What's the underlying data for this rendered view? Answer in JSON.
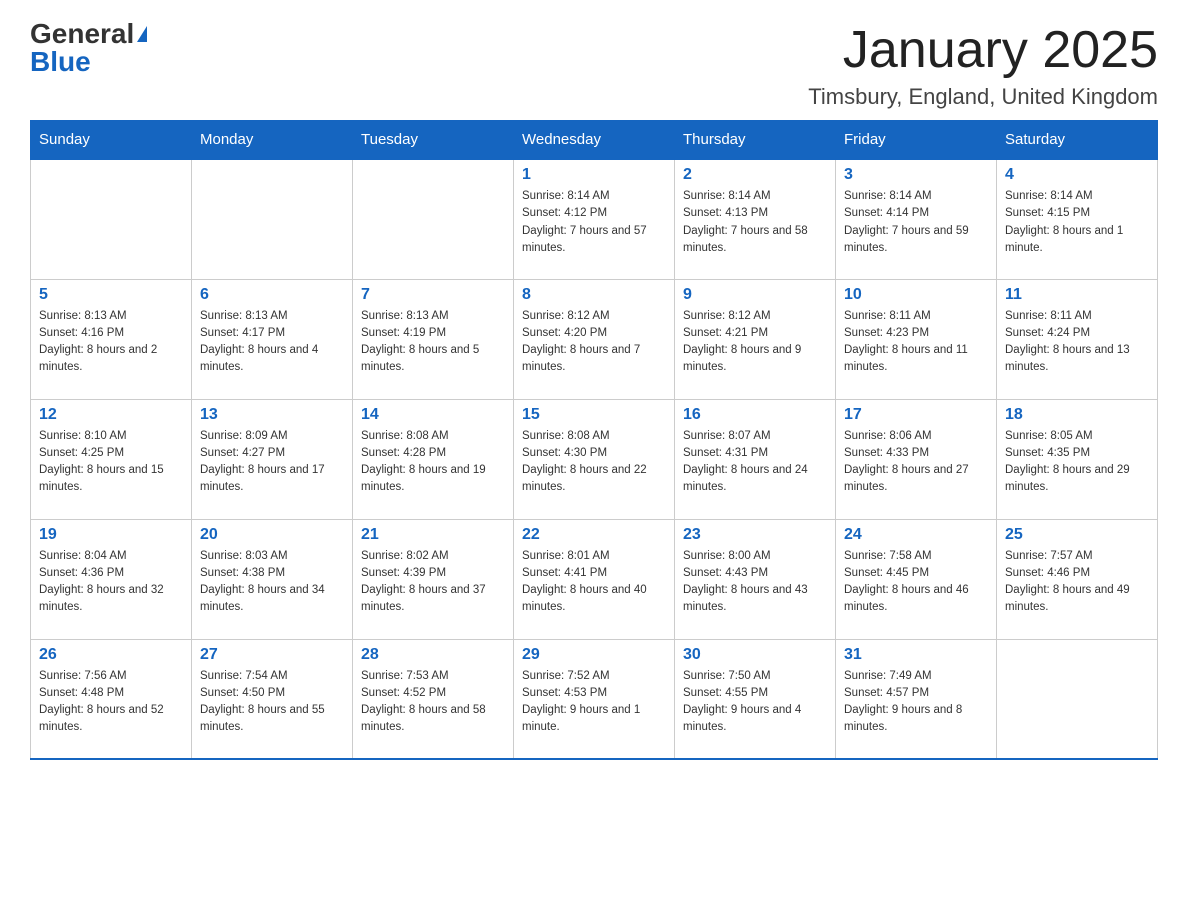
{
  "header": {
    "logo_general": "General",
    "logo_blue": "Blue",
    "month_title": "January 2025",
    "location": "Timsbury, England, United Kingdom"
  },
  "weekdays": [
    "Sunday",
    "Monday",
    "Tuesday",
    "Wednesday",
    "Thursday",
    "Friday",
    "Saturday"
  ],
  "weeks": [
    [
      {
        "day": "",
        "sunrise": "",
        "sunset": "",
        "daylight": ""
      },
      {
        "day": "",
        "sunrise": "",
        "sunset": "",
        "daylight": ""
      },
      {
        "day": "",
        "sunrise": "",
        "sunset": "",
        "daylight": ""
      },
      {
        "day": "1",
        "sunrise": "Sunrise: 8:14 AM",
        "sunset": "Sunset: 4:12 PM",
        "daylight": "Daylight: 7 hours and 57 minutes."
      },
      {
        "day": "2",
        "sunrise": "Sunrise: 8:14 AM",
        "sunset": "Sunset: 4:13 PM",
        "daylight": "Daylight: 7 hours and 58 minutes."
      },
      {
        "day": "3",
        "sunrise": "Sunrise: 8:14 AM",
        "sunset": "Sunset: 4:14 PM",
        "daylight": "Daylight: 7 hours and 59 minutes."
      },
      {
        "day": "4",
        "sunrise": "Sunrise: 8:14 AM",
        "sunset": "Sunset: 4:15 PM",
        "daylight": "Daylight: 8 hours and 1 minute."
      }
    ],
    [
      {
        "day": "5",
        "sunrise": "Sunrise: 8:13 AM",
        "sunset": "Sunset: 4:16 PM",
        "daylight": "Daylight: 8 hours and 2 minutes."
      },
      {
        "day": "6",
        "sunrise": "Sunrise: 8:13 AM",
        "sunset": "Sunset: 4:17 PM",
        "daylight": "Daylight: 8 hours and 4 minutes."
      },
      {
        "day": "7",
        "sunrise": "Sunrise: 8:13 AM",
        "sunset": "Sunset: 4:19 PM",
        "daylight": "Daylight: 8 hours and 5 minutes."
      },
      {
        "day": "8",
        "sunrise": "Sunrise: 8:12 AM",
        "sunset": "Sunset: 4:20 PM",
        "daylight": "Daylight: 8 hours and 7 minutes."
      },
      {
        "day": "9",
        "sunrise": "Sunrise: 8:12 AM",
        "sunset": "Sunset: 4:21 PM",
        "daylight": "Daylight: 8 hours and 9 minutes."
      },
      {
        "day": "10",
        "sunrise": "Sunrise: 8:11 AM",
        "sunset": "Sunset: 4:23 PM",
        "daylight": "Daylight: 8 hours and 11 minutes."
      },
      {
        "day": "11",
        "sunrise": "Sunrise: 8:11 AM",
        "sunset": "Sunset: 4:24 PM",
        "daylight": "Daylight: 8 hours and 13 minutes."
      }
    ],
    [
      {
        "day": "12",
        "sunrise": "Sunrise: 8:10 AM",
        "sunset": "Sunset: 4:25 PM",
        "daylight": "Daylight: 8 hours and 15 minutes."
      },
      {
        "day": "13",
        "sunrise": "Sunrise: 8:09 AM",
        "sunset": "Sunset: 4:27 PM",
        "daylight": "Daylight: 8 hours and 17 minutes."
      },
      {
        "day": "14",
        "sunrise": "Sunrise: 8:08 AM",
        "sunset": "Sunset: 4:28 PM",
        "daylight": "Daylight: 8 hours and 19 minutes."
      },
      {
        "day": "15",
        "sunrise": "Sunrise: 8:08 AM",
        "sunset": "Sunset: 4:30 PM",
        "daylight": "Daylight: 8 hours and 22 minutes."
      },
      {
        "day": "16",
        "sunrise": "Sunrise: 8:07 AM",
        "sunset": "Sunset: 4:31 PM",
        "daylight": "Daylight: 8 hours and 24 minutes."
      },
      {
        "day": "17",
        "sunrise": "Sunrise: 8:06 AM",
        "sunset": "Sunset: 4:33 PM",
        "daylight": "Daylight: 8 hours and 27 minutes."
      },
      {
        "day": "18",
        "sunrise": "Sunrise: 8:05 AM",
        "sunset": "Sunset: 4:35 PM",
        "daylight": "Daylight: 8 hours and 29 minutes."
      }
    ],
    [
      {
        "day": "19",
        "sunrise": "Sunrise: 8:04 AM",
        "sunset": "Sunset: 4:36 PM",
        "daylight": "Daylight: 8 hours and 32 minutes."
      },
      {
        "day": "20",
        "sunrise": "Sunrise: 8:03 AM",
        "sunset": "Sunset: 4:38 PM",
        "daylight": "Daylight: 8 hours and 34 minutes."
      },
      {
        "day": "21",
        "sunrise": "Sunrise: 8:02 AM",
        "sunset": "Sunset: 4:39 PM",
        "daylight": "Daylight: 8 hours and 37 minutes."
      },
      {
        "day": "22",
        "sunrise": "Sunrise: 8:01 AM",
        "sunset": "Sunset: 4:41 PM",
        "daylight": "Daylight: 8 hours and 40 minutes."
      },
      {
        "day": "23",
        "sunrise": "Sunrise: 8:00 AM",
        "sunset": "Sunset: 4:43 PM",
        "daylight": "Daylight: 8 hours and 43 minutes."
      },
      {
        "day": "24",
        "sunrise": "Sunrise: 7:58 AM",
        "sunset": "Sunset: 4:45 PM",
        "daylight": "Daylight: 8 hours and 46 minutes."
      },
      {
        "day": "25",
        "sunrise": "Sunrise: 7:57 AM",
        "sunset": "Sunset: 4:46 PM",
        "daylight": "Daylight: 8 hours and 49 minutes."
      }
    ],
    [
      {
        "day": "26",
        "sunrise": "Sunrise: 7:56 AM",
        "sunset": "Sunset: 4:48 PM",
        "daylight": "Daylight: 8 hours and 52 minutes."
      },
      {
        "day": "27",
        "sunrise": "Sunrise: 7:54 AM",
        "sunset": "Sunset: 4:50 PM",
        "daylight": "Daylight: 8 hours and 55 minutes."
      },
      {
        "day": "28",
        "sunrise": "Sunrise: 7:53 AM",
        "sunset": "Sunset: 4:52 PM",
        "daylight": "Daylight: 8 hours and 58 minutes."
      },
      {
        "day": "29",
        "sunrise": "Sunrise: 7:52 AM",
        "sunset": "Sunset: 4:53 PM",
        "daylight": "Daylight: 9 hours and 1 minute."
      },
      {
        "day": "30",
        "sunrise": "Sunrise: 7:50 AM",
        "sunset": "Sunset: 4:55 PM",
        "daylight": "Daylight: 9 hours and 4 minutes."
      },
      {
        "day": "31",
        "sunrise": "Sunrise: 7:49 AM",
        "sunset": "Sunset: 4:57 PM",
        "daylight": "Daylight: 9 hours and 8 minutes."
      },
      {
        "day": "",
        "sunrise": "",
        "sunset": "",
        "daylight": ""
      }
    ]
  ]
}
